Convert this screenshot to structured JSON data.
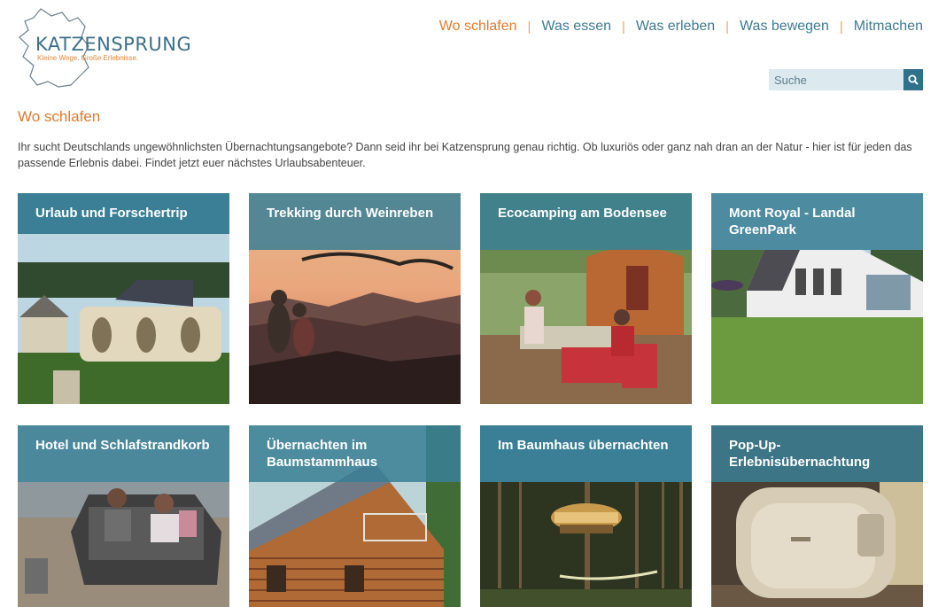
{
  "logo": {
    "title": "KATZENSPRUNG",
    "tagline": "Kleine Wege. Große Erlebnisse."
  },
  "nav": {
    "items": [
      {
        "label": "Wo schlafen",
        "active": true
      },
      {
        "label": "Was essen",
        "active": false
      },
      {
        "label": "Was erleben",
        "active": false
      },
      {
        "label": "Was bewegen",
        "active": false
      },
      {
        "label": "Mitmachen",
        "active": false
      }
    ],
    "separator": "|"
  },
  "search": {
    "placeholder": "Suche",
    "icon": "search-icon"
  },
  "page": {
    "title": "Wo schlafen",
    "intro": "Ihr sucht Deutschlands ungewöhnlichsten Übernachtungsangebote? Dann seid ihr bei Katzensprung genau richtig. Ob luxuriös oder ganz nah dran an der Natur - hier ist für jeden das passende Erlebnis dabei. Findet jetzt euer nächstes Urlaubsabenteuer."
  },
  "cards": [
    {
      "title": "Urlaub und Forschertrip"
    },
    {
      "title": "Trekking durch Weinreben"
    },
    {
      "title": "Ecocamping am Bodensee"
    },
    {
      "title": "Mont Royal - Landal GreenPark"
    },
    {
      "title": "Hotel und Schlafstrandkorb"
    },
    {
      "title": "Übernachten im Baumstammhaus"
    },
    {
      "title": "Im Baumhaus übernachten"
    },
    {
      "title": "Pop-Up-Erlebnisübernachtung"
    }
  ],
  "colors": {
    "accent_orange": "#e07b2e",
    "nav_blue": "#3d7b92",
    "card_label": "#3a7f95",
    "search_bg": "#dce9ef",
    "search_button": "#2f7188"
  }
}
